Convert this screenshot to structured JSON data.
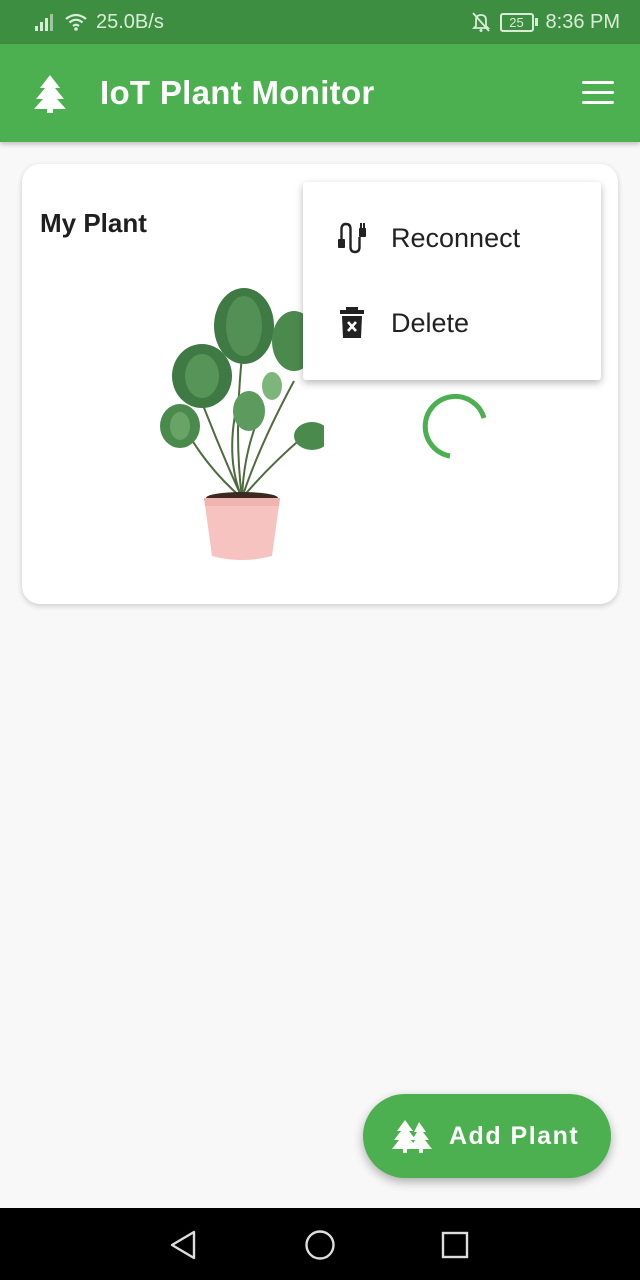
{
  "status_bar": {
    "network_speed": "25.0B/s",
    "battery_level": "25",
    "time": "8:36 PM",
    "icons": [
      "signal-icon",
      "wifi-icon",
      "bell-off-icon",
      "battery-icon"
    ]
  },
  "app_bar": {
    "title": "IoT Plant Monitor",
    "logo_icon": "tree-icon",
    "menu_icon": "hamburger-menu-icon"
  },
  "plant_card": {
    "name": "My Plant",
    "image": "potted-monstera-plant",
    "status": "loading"
  },
  "context_menu": {
    "items": [
      {
        "label": "Reconnect",
        "icon": "plug-icon"
      },
      {
        "label": "Delete",
        "icon": "trash-icon"
      }
    ]
  },
  "fab": {
    "label": "Add Plant",
    "icon": "trees-icon"
  },
  "nav_bar": {
    "buttons": [
      "back-icon",
      "home-icon",
      "recents-icon"
    ]
  },
  "colors": {
    "primary": "#4caf50",
    "status_bar": "#3e8e41",
    "background": "#f8f8f8",
    "pot": "#f6c3c0",
    "leaf": "#3f7a45"
  }
}
